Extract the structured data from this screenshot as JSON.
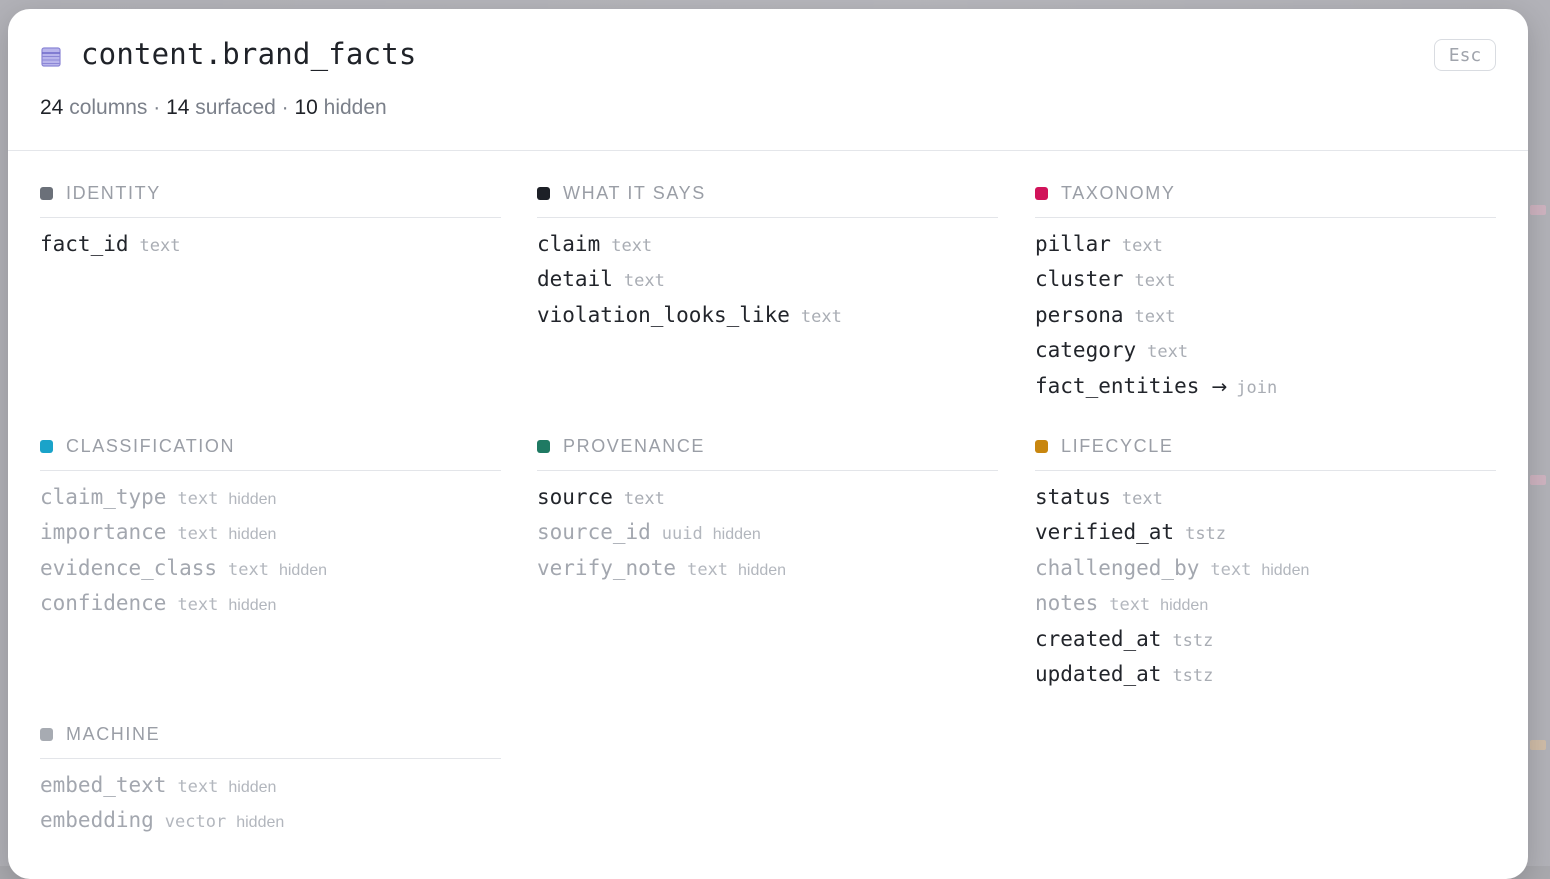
{
  "dialog": {
    "title": "content.brand_facts",
    "close_label": "Esc",
    "summary": {
      "columns_count": "24",
      "columns_label": " columns · ",
      "surfaced_count": "14",
      "surfaced_label": " surfaced · ",
      "hidden_count": "10",
      "hidden_label": " hidden"
    }
  },
  "groups": [
    {
      "title": "IDENTITY",
      "color": "#6b7079",
      "columns": [
        {
          "name": "fact_id",
          "type": "text",
          "hidden": false
        }
      ]
    },
    {
      "title": "WHAT IT SAYS",
      "color": "#1d2027",
      "columns": [
        {
          "name": "claim",
          "type": "text",
          "hidden": false
        },
        {
          "name": "detail",
          "type": "text",
          "hidden": false
        },
        {
          "name": "violation_looks_like",
          "type": "text",
          "hidden": false
        }
      ]
    },
    {
      "title": "TAXONOMY",
      "color": "#d1135a",
      "columns": [
        {
          "name": "pillar",
          "type": "text",
          "hidden": false
        },
        {
          "name": "cluster",
          "type": "text",
          "hidden": false
        },
        {
          "name": "persona",
          "type": "text",
          "hidden": false
        },
        {
          "name": "category",
          "type": "text",
          "hidden": false
        },
        {
          "name": "fact_entities",
          "type": "join",
          "hidden": false,
          "join": true
        }
      ]
    },
    {
      "title": "CLASSIFICATION",
      "color": "#1aa3c9",
      "columns": [
        {
          "name": "claim_type",
          "type": "text",
          "hidden": true
        },
        {
          "name": "importance",
          "type": "text",
          "hidden": true
        },
        {
          "name": "evidence_class",
          "type": "text",
          "hidden": true
        },
        {
          "name": "confidence",
          "type": "text",
          "hidden": true
        }
      ]
    },
    {
      "title": "PROVENANCE",
      "color": "#1f7a63",
      "columns": [
        {
          "name": "source",
          "type": "text",
          "hidden": false
        },
        {
          "name": "source_id",
          "type": "uuid",
          "hidden": true
        },
        {
          "name": "verify_note",
          "type": "text",
          "hidden": true
        }
      ]
    },
    {
      "title": "LIFECYCLE",
      "color": "#c8860f",
      "columns": [
        {
          "name": "status",
          "type": "text",
          "hidden": false
        },
        {
          "name": "verified_at",
          "type": "tstz",
          "hidden": false
        },
        {
          "name": "challenged_by",
          "type": "text",
          "hidden": true
        },
        {
          "name": "notes",
          "type": "text",
          "hidden": true
        },
        {
          "name": "created_at",
          "type": "tstz",
          "hidden": false
        },
        {
          "name": "updated_at",
          "type": "tstz",
          "hidden": false
        }
      ]
    },
    {
      "title": "MACHINE",
      "color": "#a7abb2",
      "columns": [
        {
          "name": "embed_text",
          "type": "text",
          "hidden": true
        },
        {
          "name": "embedding",
          "type": "vector",
          "hidden": true
        }
      ]
    }
  ],
  "labels": {
    "hidden_tag": "hidden",
    "join_arrow": "→"
  },
  "colors": {
    "icon": "#8b86d6"
  }
}
